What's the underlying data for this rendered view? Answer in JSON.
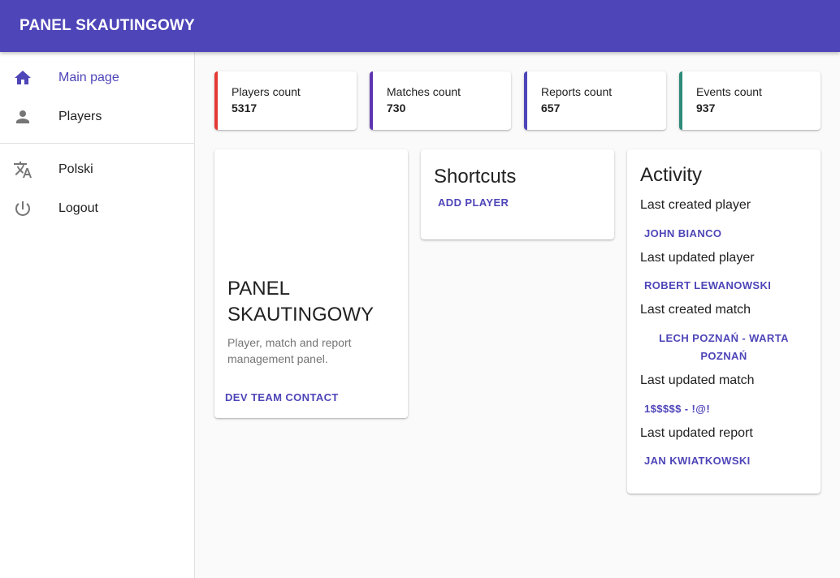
{
  "app": {
    "title": "PANEL SKAUTINGOWY"
  },
  "colors": {
    "primary": "#4e45b8",
    "red": "#e53935",
    "purple": "#5e35b1",
    "indigo": "#4e45b8",
    "teal": "#2e8b7a"
  },
  "nav": {
    "items": [
      {
        "label": "Main page",
        "icon": "home-icon",
        "active": true
      },
      {
        "label": "Players",
        "icon": "person-icon"
      }
    ],
    "secondary": [
      {
        "label": "Polski",
        "icon": "translate-icon"
      },
      {
        "label": "Logout",
        "icon": "power-icon"
      }
    ]
  },
  "stats": [
    {
      "label": "Players count",
      "value": "5317"
    },
    {
      "label": "Matches count",
      "value": "730"
    },
    {
      "label": "Reports count",
      "value": "657"
    },
    {
      "label": "Events count",
      "value": "937"
    }
  ],
  "info": {
    "title": "PANEL SKAUTINGOWY",
    "description": "Player, match and report management panel.",
    "contact_label": "DEV TEAM CONTACT"
  },
  "shortcuts": {
    "title": "Shortcuts",
    "add_player_label": "ADD PLAYER"
  },
  "activity": {
    "title": "Activity",
    "items": [
      {
        "label": "Last created player",
        "value": "JOHN BIANCO"
      },
      {
        "label": "Last updated player",
        "value": "ROBERT LEWANOWSKI"
      },
      {
        "label": "Last created match",
        "value": "LECH POZNAŃ - WARTA POZNAŃ"
      },
      {
        "label": "Last updated match",
        "value": "1$$$$$ - !@!"
      },
      {
        "label": "Last updated report",
        "value": "JAN KWIATKOWSKI"
      }
    ]
  }
}
